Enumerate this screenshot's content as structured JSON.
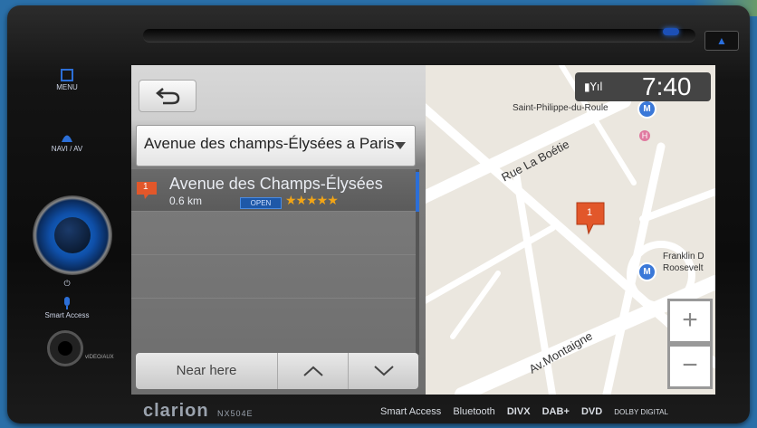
{
  "device": {
    "brand": "clarion",
    "model": "NX504E",
    "side_buttons": {
      "menu": "MENU",
      "navi_av": "NAVI / AV",
      "smart_access": "Smart Access"
    },
    "port_label": "vIDEO/AUX",
    "features": [
      "Smart Access",
      "Bluetooth",
      "DIVX",
      "DAB+",
      "DVD",
      "DOLBY DIGITAL"
    ]
  },
  "screen": {
    "search": {
      "value": "Avenue des champs-Élysées a Paris"
    },
    "result": {
      "badge": "1",
      "title": "Avenue des Champs-Élysées",
      "distance": "0.6 km",
      "status": "OPEN",
      "rating": "★★★★★"
    },
    "bottom_bar": {
      "near_here": "Near here"
    },
    "map": {
      "clock": "7:40",
      "status_icons": "▮Yıl",
      "labels": {
        "saint_philippe": "Saint-Philippe-du-Roule",
        "rue_boetie": "Rue La Boétie",
        "franklin": "Franklin D",
        "roosevelt": "Roosevelt",
        "montaigne": "Av.Montaigne"
      },
      "metro_glyph": "M",
      "marker_badge": "1",
      "zoom_in": "+",
      "zoom_out": "−"
    }
  },
  "colors": {
    "accent_blue": "#2c6fd8",
    "pin_orange": "#e2572a",
    "stars": "#f2a516"
  }
}
